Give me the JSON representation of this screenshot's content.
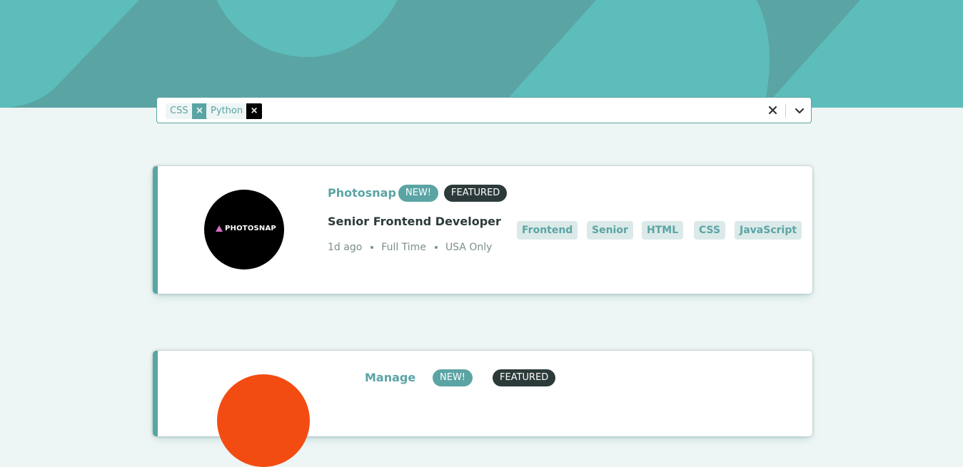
{
  "filters": {
    "chips": [
      {
        "label": "CSS"
      },
      {
        "label": "Python"
      }
    ],
    "remove_symbol": "×"
  },
  "jobs": [
    {
      "company": "Photosnap",
      "logo_text": "PHOTOSNAP",
      "logo_color": "#000000",
      "is_new": "NEW!",
      "is_featured": "FEATURED",
      "position": "Senior Frontend Developer",
      "posted_at": "1d ago",
      "contract": "Full Time",
      "location": "USA Only",
      "tags": [
        "Frontend",
        "Senior",
        "HTML",
        "CSS",
        "JavaScript"
      ]
    },
    {
      "company": "Manage",
      "logo_color": "#f24c12",
      "is_new": "NEW!",
      "is_featured": "FEATURED"
    }
  ],
  "colors": {
    "accent": "#5ba4a4",
    "background": "#eef6f5",
    "tag_background": "#dbe9e9",
    "dark": "#2c3a3a",
    "muted": "#7b8e8e"
  }
}
